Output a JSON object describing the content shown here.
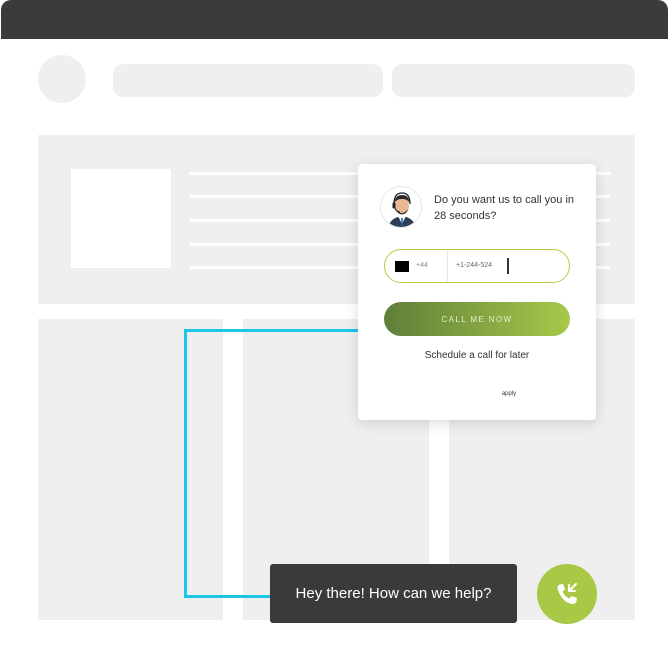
{
  "popup": {
    "question": "Do you want us to call you in 28 seconds?",
    "country_code": "+44",
    "phone_value": "+1-244-524",
    "call_button": "CALL ME NOW",
    "schedule_link": "Schedule a call for later",
    "footer": "apply"
  },
  "chat": {
    "greeting": "Hey there! How can we help?"
  },
  "colors": {
    "titlebar": "#3b3b3b",
    "placeholder": "#efefef",
    "connector": "#1bc6e6",
    "accent_green": "#a9c846",
    "button_gradient_start": "#5e7f39",
    "chat_bubble": "#3a3a3a"
  },
  "icons": {
    "agent": "agent-avatar-icon",
    "phone": "phone-call-icon",
    "flag": "flag-icon"
  }
}
